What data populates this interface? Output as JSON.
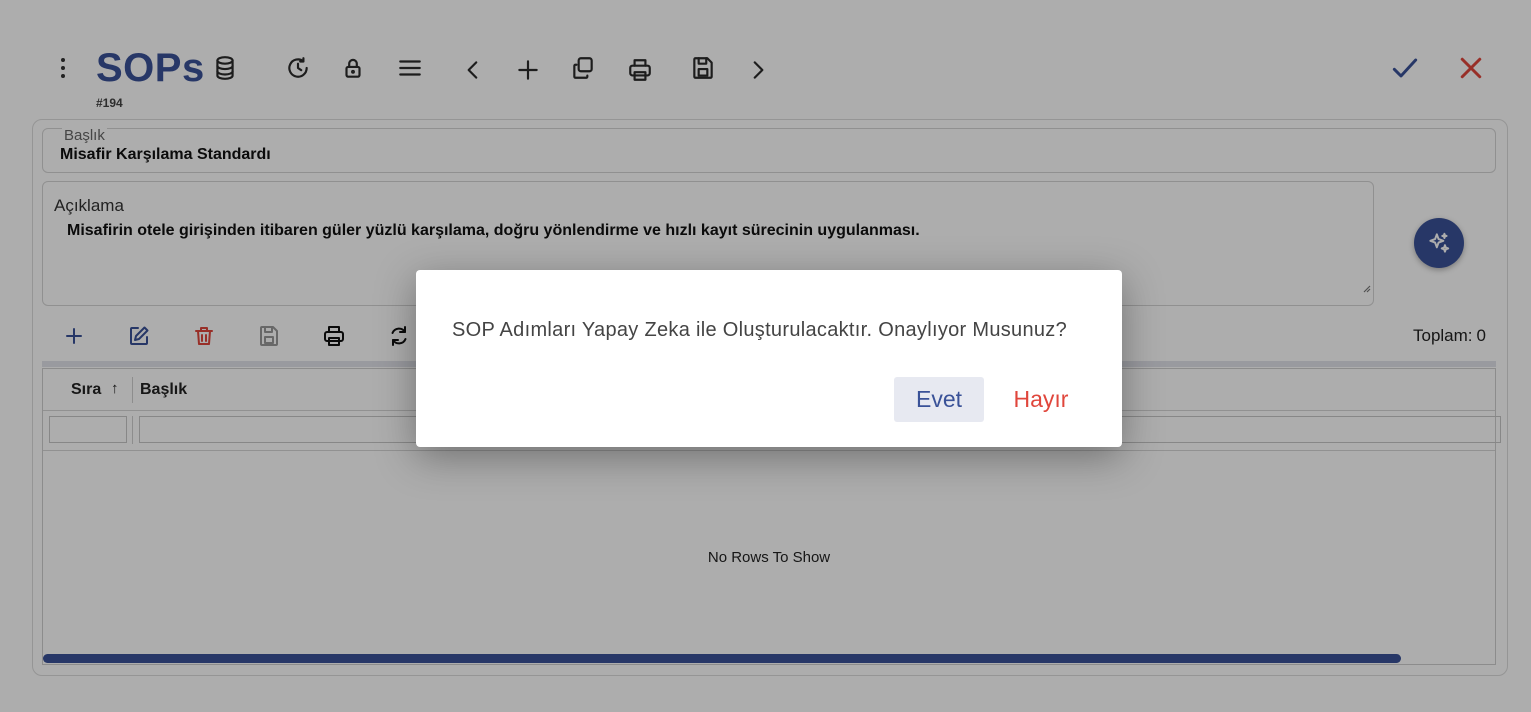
{
  "header": {
    "title": "SOPs",
    "record_id": "#194",
    "icons": [
      "kebab-menu-icon",
      "database-icon",
      "history-icon",
      "lock-icon",
      "menu-lines-icon",
      "chevron-left-icon",
      "plus-icon",
      "copy-icon",
      "print-icon",
      "save-icon",
      "chevron-right-icon",
      "check-icon",
      "close-icon"
    ]
  },
  "form": {
    "title_label": "Başlık",
    "title_value": "Misafir Karşılama Standardı",
    "description_label": "Açıklama",
    "description_value": "Misafirin otele girişinden itibaren güler yüzlü karşılama, doğru yönlendirme ve hızlı kayıt sürecinin uygulanması."
  },
  "grid_toolbar": {
    "icons": [
      "add-icon",
      "edit-icon",
      "delete-icon",
      "save-icon",
      "print-icon",
      "refresh-icon"
    ],
    "total_label": "Toplam:",
    "total_value": "0"
  },
  "grid": {
    "columns": [
      "Sıra",
      "Başlık"
    ],
    "sort_indicator": "↑",
    "empty_text": "No Rows To Show"
  },
  "dialog": {
    "message": "SOP Adımları Yapay Zeka ile Oluşturulacaktır. Onaylıyor Musunuz?",
    "yes_label": "Evet",
    "no_label": "Hayır"
  },
  "colors": {
    "brand": "#3a5298",
    "danger": "#e0463c",
    "overlay": "rgba(0,0,0,0.32)"
  }
}
